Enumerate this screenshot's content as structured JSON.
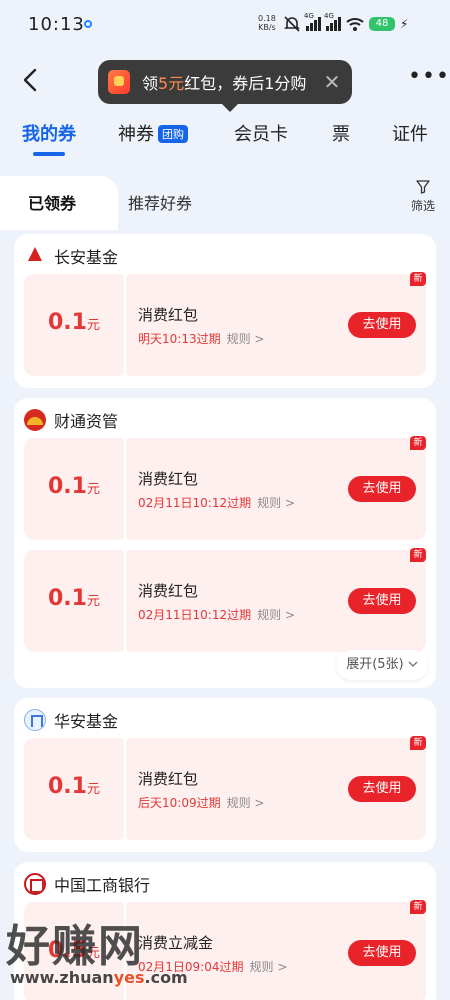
{
  "status": {
    "time": "10:13",
    "net_speed": "0.18",
    "net_unit": "KB/s",
    "lte1": "4G",
    "lte2": "4G",
    "battery": "48"
  },
  "nav": {
    "tooltip_prefix": "领",
    "tooltip_highlight": "5元",
    "tooltip_suffix": "红包，券后1分购"
  },
  "tabs": [
    {
      "label": "我的券",
      "active": true
    },
    {
      "label": "神券",
      "tag": "团购"
    },
    {
      "label": "会员卡"
    },
    {
      "label": "票"
    },
    {
      "label": "证件"
    }
  ],
  "subtabs": {
    "active": "已领券",
    "other": "推荐好券",
    "filter": "筛选"
  },
  "coupon_common": {
    "use_label": "去使用",
    "new_label": "新",
    "rule_label": "规则 >",
    "unit": "元"
  },
  "cards": [
    {
      "title": "长安基金",
      "coupons": [
        {
          "amount": "0.1",
          "name": "消费红包",
          "expiry": "明天10:13过期"
        }
      ]
    },
    {
      "title": "财通资管",
      "coupons": [
        {
          "amount": "0.1",
          "name": "消费红包",
          "expiry": "02月11日10:12过期"
        },
        {
          "amount": "0.1",
          "name": "消费红包",
          "expiry": "02月11日10:12过期"
        }
      ],
      "expand_label": "展开(5张)"
    },
    {
      "title": "华安基金",
      "coupons": [
        {
          "amount": "0.1",
          "name": "消费红包",
          "expiry": "后天10:09过期"
        }
      ]
    },
    {
      "title": "中国工商银行",
      "coupons": [
        {
          "amount": "0.5",
          "name": "消费立减金",
          "expiry": "02月1日09:04过期"
        }
      ]
    }
  ],
  "watermark": {
    "brand": "好赚网",
    "url_a": "www.zhuan",
    "url_b": "yes",
    "url_c": ".com"
  },
  "colors": {
    "accent": "#1565e8",
    "red": "#e8242a",
    "coupon_bg": "#fff0f0",
    "page_bg": "#eef3fb"
  }
}
